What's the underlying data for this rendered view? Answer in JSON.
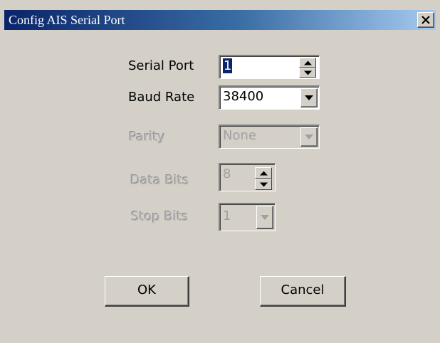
{
  "window": {
    "title": "Config AIS Serial Port",
    "close_glyph": "close-icon"
  },
  "form": {
    "serial_port": {
      "label": "Serial Port",
      "value": "1",
      "enabled": true
    },
    "baud_rate": {
      "label": "Baud Rate",
      "value": "38400",
      "enabled": true
    },
    "parity": {
      "label": "Parity",
      "value": "None",
      "enabled": false
    },
    "data_bits": {
      "label": "Data Bits",
      "value": "8",
      "enabled": false
    },
    "stop_bits": {
      "label": "Stop Bits",
      "value": "1",
      "enabled": false
    }
  },
  "buttons": {
    "ok_label": "OK",
    "cancel_label": "Cancel"
  },
  "colors": {
    "title_start": "#0a246a",
    "title_end": "#a6caf0",
    "face": "#d4d0c8",
    "selection": "#0a246a"
  }
}
